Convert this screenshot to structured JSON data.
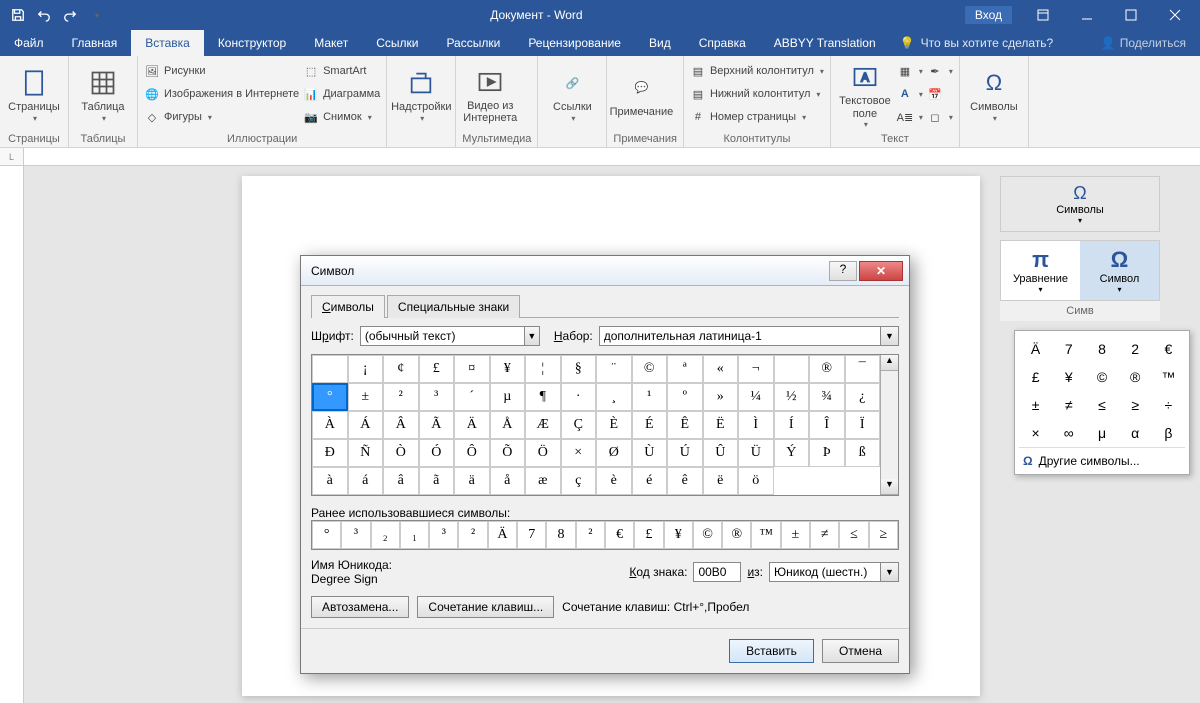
{
  "title": "Документ  -  Word",
  "login": "Вход",
  "tabs": [
    "Файл",
    "Главная",
    "Вставка",
    "Конструктор",
    "Макет",
    "Ссылки",
    "Рассылки",
    "Рецензирование",
    "Вид",
    "Справка",
    "ABBYY Translation"
  ],
  "active_tab": 2,
  "tell_me": "Что вы хотите сделать?",
  "share": "Поделиться",
  "ribbon": {
    "pages": {
      "label": "Страницы",
      "btn": "Страницы"
    },
    "table": {
      "label": "Таблицы",
      "btn": "Таблица"
    },
    "illus": {
      "label": "Иллюстрации",
      "pic": "Рисунки",
      "online": "Изображения в Интернете",
      "shapes": "Фигуры",
      "smart": "SmartArt",
      "chart": "Диаграмма",
      "screen": "Снимок"
    },
    "addins": {
      "label": "",
      "btn": "Надстройки"
    },
    "media": {
      "label": "Мультимедиа",
      "btn": "Видео из\nИнтернета"
    },
    "links": {
      "label": "",
      "btn": "Ссылки"
    },
    "comment": {
      "label": "Примечания",
      "btn": "Примечание"
    },
    "hf": {
      "label": "Колонтитулы",
      "header": "Верхний колонтитул",
      "footer": "Нижний колонтитул",
      "page": "Номер страницы"
    },
    "text": {
      "label": "Текст",
      "box": "Текстовое\nполе"
    },
    "symbols": {
      "label": "",
      "btn": "Символы"
    }
  },
  "ruler_corner": "L",
  "side": {
    "head": "Символы",
    "eq": "Уравнение",
    "sym": "Символ",
    "group": "Симв"
  },
  "sym_drop": {
    "cells": [
      "Ä",
      "7",
      "8",
      "2",
      "€",
      "£",
      "¥",
      "©",
      "®",
      "™",
      "±",
      "≠",
      "≤",
      "≥",
      "÷",
      "×",
      "∞",
      "μ",
      "α",
      "β"
    ],
    "more": "Другие символы..."
  },
  "dialog": {
    "title": "Символ",
    "tab_sym": "Символы",
    "tab_spec": "Специальные знаки",
    "font_lbl": "Шрифт:",
    "font_val": "(обычный текст)",
    "set_lbl": "Набор:",
    "set_val": "дополнительная латиница-1",
    "grid": [
      " ",
      "¡",
      "¢",
      "£",
      "¤",
      "¥",
      "¦",
      "§",
      "¨",
      "©",
      "ª",
      "«",
      "¬",
      "­",
      "®",
      "¯",
      "°",
      "±",
      "²",
      "³",
      "´",
      "µ",
      "¶",
      "·",
      "¸",
      "¹",
      "º",
      "»",
      "¼",
      "½",
      "¾",
      "¿",
      "À",
      "Á",
      "Â",
      "Ã",
      "Ä",
      "Å",
      "Æ",
      "Ç",
      "È",
      "É",
      "Ê",
      "Ë",
      "Ì",
      "Í",
      "Î",
      "Ï",
      "Ð",
      "Ñ",
      "Ò",
      "Ó",
      "Ô",
      "Õ",
      "Ö",
      "×",
      "Ø",
      "Ù",
      "Ú",
      "Û",
      "Ü",
      "Ý",
      "Þ",
      "ß",
      "à",
      "á",
      "â",
      "ã",
      "ä",
      "å",
      "æ",
      "ç",
      "è",
      "é",
      "ê",
      "ë",
      "ö"
    ],
    "selected_index": 16,
    "recent_lbl": "Ранее использовавшиеся символы:",
    "recent": [
      "°",
      "³",
      "₂",
      "₁",
      "³",
      "²",
      "Ä",
      "7",
      "8",
      "²",
      "€",
      "£",
      "¥",
      "©",
      "®",
      "™",
      "±",
      "≠",
      "≤",
      "≥"
    ],
    "uname_lbl": "Имя Юникода:",
    "uname_val": "Degree Sign",
    "code_lbl": "Код знака:",
    "code_val": "00B0",
    "from_lbl": "из:",
    "from_val": "Юникод (шестн.)",
    "auto": "Автозамена...",
    "shortcut": "Сочетание клавиш...",
    "shortcut_info": "Сочетание клавиш: Ctrl+°,Пробел",
    "insert": "Вставить",
    "cancel": "Отмена"
  }
}
